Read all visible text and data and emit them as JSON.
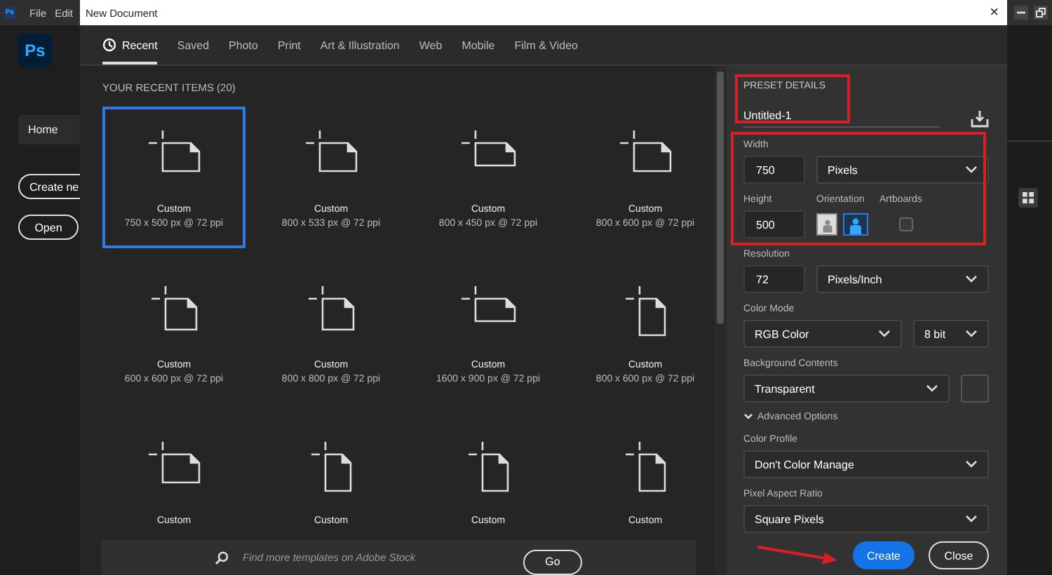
{
  "app_menu": {
    "logo": "Ps",
    "items": [
      "File",
      "Edit"
    ]
  },
  "sidebar": {
    "logo": "Ps",
    "items": [
      {
        "label": "Home",
        "selected": true
      }
    ],
    "buttons": [
      "Create ne",
      "Open"
    ]
  },
  "dialog": {
    "title": "New Document",
    "close": "×",
    "tabs": [
      {
        "label": "Recent",
        "selected": true
      },
      {
        "label": "Saved",
        "selected": false
      },
      {
        "label": "Photo",
        "selected": false
      },
      {
        "label": "Print",
        "selected": false
      },
      {
        "label": "Art & Illustration",
        "selected": false
      },
      {
        "label": "Web",
        "selected": false
      },
      {
        "label": "Mobile",
        "selected": false
      },
      {
        "label": "Film & Video",
        "selected": false
      }
    ],
    "recent": {
      "heading": "YOUR RECENT ITEMS  (20)",
      "items": [
        {
          "name": "Custom",
          "size": "750 x 500 px @ 72 ppi",
          "kind": "landscape",
          "selected": true
        },
        {
          "name": "Custom",
          "size": "800 x 533 px @ 72 ppi",
          "kind": "landscape",
          "selected": false
        },
        {
          "name": "Custom",
          "size": "800 x 450 px @ 72 ppi",
          "kind": "wide",
          "selected": false
        },
        {
          "name": "Custom",
          "size": "800 x 600 px @ 72 ppi",
          "kind": "landscape",
          "selected": false
        },
        {
          "name": "Custom",
          "size": "600 x 600 px @ 72 ppi",
          "kind": "square",
          "selected": false
        },
        {
          "name": "Custom",
          "size": "800 x 800 px @ 72 ppi",
          "kind": "square",
          "selected": false
        },
        {
          "name": "Custom",
          "size": "1600 x 900 px @ 72 ppi",
          "kind": "wide",
          "selected": false
        },
        {
          "name": "Custom",
          "size": "800 x 600 px @ 72 ppi",
          "kind": "portrait",
          "selected": false
        },
        {
          "name": "Custom",
          "kind": "landscape",
          "selected": false
        },
        {
          "name": "Custom",
          "kind": "portrait",
          "selected": false
        },
        {
          "name": "Custom",
          "kind": "portrait",
          "selected": false
        },
        {
          "name": "Custom",
          "kind": "portrait",
          "selected": false
        }
      ]
    },
    "search": {
      "placeholder": "Find more templates on Adobe Stock",
      "button": "Go"
    },
    "preset": {
      "heading": "PRESET DETAILS",
      "name": "Untitled-1",
      "width": {
        "label": "Width",
        "value": "750",
        "unit": "Pixels"
      },
      "height": {
        "label": "Height",
        "value": "500"
      },
      "orientation": {
        "label": "Orientation",
        "options": [
          {
            "kind": "portrait",
            "selected": false
          },
          {
            "kind": "landscape",
            "selected": true
          }
        ]
      },
      "artboards": {
        "label": "Artboards",
        "checked": false
      },
      "resolution": {
        "label": "Resolution",
        "value": "72",
        "unit": "Pixels/Inch"
      },
      "color_mode": {
        "label": "Color Mode",
        "mode": "RGB Color",
        "depth": "8 bit"
      },
      "background": {
        "label": "Background Contents",
        "value": "Transparent"
      },
      "advanced": {
        "label": "Advanced Options",
        "expanded": true
      },
      "color_profile": {
        "label": "Color Profile",
        "value": "Don't Color Manage"
      },
      "pixel_aspect": {
        "label": "Pixel Aspect Ratio",
        "value": "Square Pixels"
      }
    },
    "buttons": [
      {
        "label": "Create",
        "kind": "primary"
      },
      {
        "label": "Close",
        "kind": "secondary"
      }
    ]
  }
}
